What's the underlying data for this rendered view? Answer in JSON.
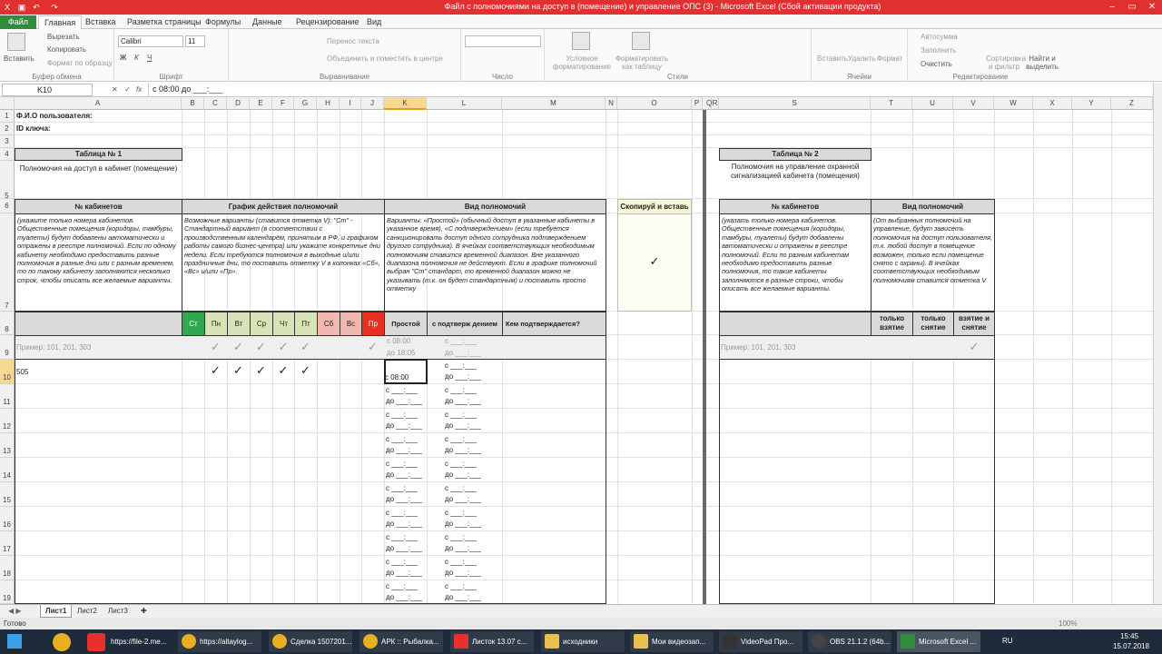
{
  "window": {
    "title": "Файл с полномочиями на доступ в (помещение) и управление ОПС (3) - Microsoft Excel (Сбой активации продукта)"
  },
  "ribbon_tabs": [
    "Файл",
    "Главная",
    "Вставка",
    "Разметка страницы",
    "Формулы",
    "Данные",
    "Рецензирование",
    "Вид"
  ],
  "ribbon": {
    "clipboard": {
      "paste": "Вставить",
      "cut": "Вырезать",
      "copy": "Копировать",
      "format": "Формат по образцу",
      "label": "Буфер обмена"
    },
    "font": {
      "name": "Calibri",
      "size": "11",
      "label": "Шрифт"
    },
    "align": {
      "wrap": "Перенос текста",
      "merge": "Объединить и поместить в центре",
      "label": "Выравнивание"
    },
    "number": {
      "label": "Число"
    },
    "styles": {
      "cond": "Условное форматирование",
      "table": "Форматировать как таблицу",
      "label": "Стили"
    },
    "cells": {
      "insert": "Вставить",
      "delete": "Удалить",
      "format": "Формат",
      "label": "Ячейки"
    },
    "edit": {
      "autosum": "Автосумма",
      "fill": "Заполнить",
      "clear": "Очистить",
      "sort": "Сортировка и фильтр",
      "find": "Найти и выделить",
      "label": "Редактирование"
    }
  },
  "formula_bar": {
    "name": "K10",
    "fx": "fx",
    "content": "с   08:00                     до ___:___"
  },
  "columns": [
    "A",
    "B",
    "C",
    "D",
    "E",
    "F",
    "G",
    "H",
    "I",
    "J",
    "K",
    "L",
    "M",
    "N",
    "O",
    "P",
    "Q",
    "R",
    "S",
    "T",
    "U",
    "V",
    "W",
    "X",
    "Y",
    "Z"
  ],
  "rows": [
    "1",
    "2",
    "3",
    "4",
    "5",
    "6",
    "7",
    "8",
    "9",
    "10",
    "11",
    "12",
    "13",
    "14",
    "15",
    "16",
    "17",
    "18",
    "19"
  ],
  "sheet": {
    "fio": "Ф.И.О пользователя:",
    "id": "ID ключа:",
    "t1_title": "Таблица № 1",
    "t1_sub": "Полномочия на доступ в кабинет (помещение)",
    "h_cab": "№ кабинетов",
    "h_graph": "График действия полномочий",
    "h_kind": "Вид полномочий",
    "h_copy": "Скопируй и вставь",
    "note_cab": "(укажите только номера кабинетов. Общественные помещения (коридоры, тамбуры, туалеты) будут добавлены автоматически и отражены в реестре полномочий. Если по одному кабинету необходимо предоставить разные полномочия в разные дни или с разным временем, то по такому кабинету заполняются несколько строк, чтобы описать все желаемые варианты.",
    "note_graph": "Возможные варианты (ставится отметка V):  \"Ст\" - Стандартный вариант (в соответствии с производственным календарём, принятым в РФ, и графиком работы самого бизнес-центра) или укажите конкретные дни недели. Если требуются полномочия в выходные и/или праздничные дни, то поставить отметку V в колонках «Сб», «Вс» и/или  «Пр».",
    "note_kind": "Варианты: «Простой» (обычный доступ в указанные кабинеты в указанное время), «С подтверждением» (если требуется санкционировать доступ одного сотрудника подтверждением другого сотрудника). В ячейках соответствующих необходимым полномочиям ставится временной диапазон. Вне указанного диапазона полномочия не действуют. Если в графике полномочий выбран \"Ст\" стандарт, то временной диапазон можно не указывать (т.к. он будет стандартным) и поставить просто отметку",
    "copy_mark": "✓",
    "days": [
      "Ст",
      "Пн",
      "Вт",
      "Ср",
      "Чт",
      "Пт",
      "Сб",
      "Вс",
      "Пр"
    ],
    "h_simple": "Простой",
    "h_confirm": "с подтверж дением",
    "h_who": "Кем подтверждается? (Ф.И.О.)",
    "example": "Пример: 101, 201, 303",
    "ex_from": "с    08:00",
    "ex_to": "до 18:05",
    "blank_from": "с   ___:___",
    "blank_to": "до ___:___",
    "row10_cab": "505",
    "row10_from": "с   08:00",
    "check": "✓",
    "t2_title": "Таблица № 2",
    "t2_sub": "Полномочия на управление охранной сигнализацией кабинета (помещения)",
    "t2_h_cab": "№ кабинетов",
    "t2_h_kind": "Вид полномочий",
    "t2_note_cab": "(указать только номера кабинетов. Общественные помещения (коридоры, тамбуры, туалеты) будут добавлены автоматически и отражены в реестре полномочий. Если по разным кабинетам необходимо предоставить разные полномочия, то такие кабинеты заполняются в разные строки, чтобы описать все желаемые варианты.",
    "t2_note_kind": "(От выбранных полномочий на управление, будут зависеть полномочия на доступ пользователя, т.к. любой доступ в помещение возможен, только если помещение снято с охраны). В ячейках соответствующих необходимым полномочиям ставится отметка V",
    "t2_arm": "только взятие",
    "t2_disarm": "только снятие",
    "t2_both": "взятие и снятие"
  },
  "sheets": [
    "Лист1",
    "Лист2",
    "Лист3"
  ],
  "status": {
    "ready": "Готово",
    "zoom": "100%"
  },
  "taskbar": {
    "items": [
      "https://file-2.me...",
      "https://altaylog...",
      "Сделка 1507201...",
      "АРК :: Рыбалка...",
      "Листок 13.07 с...",
      "исходники",
      "Мои видеозап...",
      "VideoPad Про...",
      "OBS 21.1.2 (64b...",
      "Microsoft Excel ..."
    ],
    "lang": "RU",
    "time": "15:45",
    "date": "15.07.2018"
  }
}
